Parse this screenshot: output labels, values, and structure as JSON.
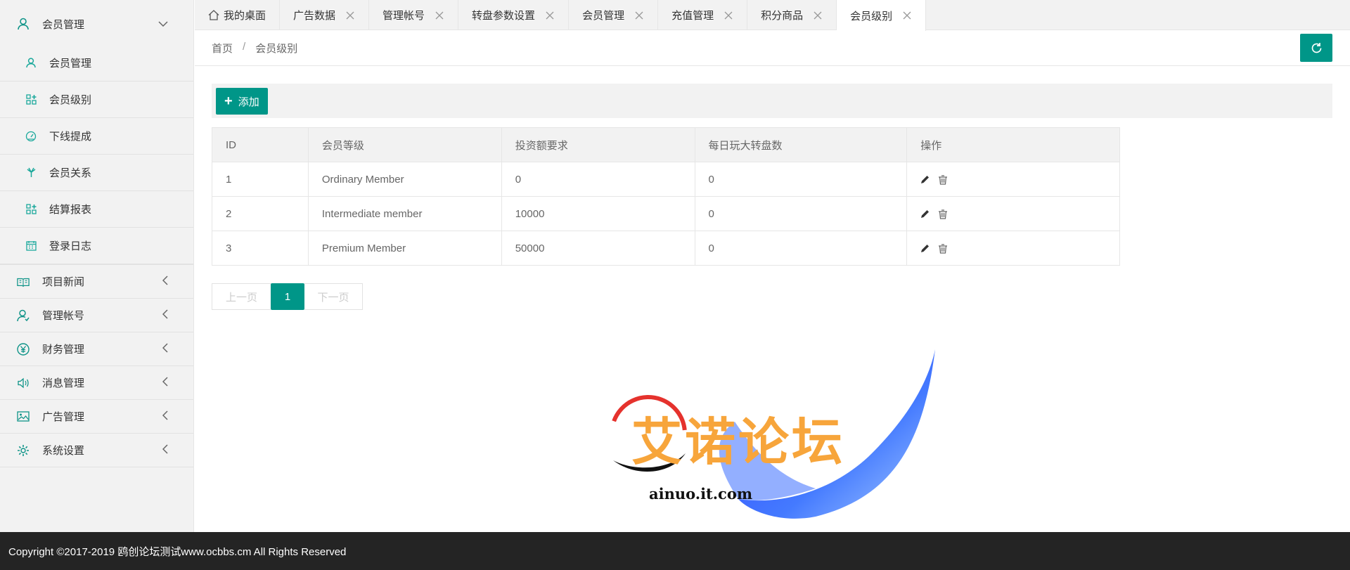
{
  "sidebar": {
    "member_group": {
      "label": "会员管理",
      "icon": "user-icon",
      "items": [
        {
          "label": "会员管理",
          "icon": "user-icon"
        },
        {
          "label": "会员级别",
          "icon": "grid-plus-icon"
        },
        {
          "label": "下线提成",
          "icon": "gauge-icon"
        },
        {
          "label": "会员关系",
          "icon": "network-icon"
        },
        {
          "label": "结算报表",
          "icon": "grid-plus-icon"
        },
        {
          "label": "登录日志",
          "icon": "calendar-icon"
        }
      ]
    },
    "groups": [
      {
        "label": "项目新闻",
        "icon": "book-icon"
      },
      {
        "label": "管理帐号",
        "icon": "admin-user-icon"
      },
      {
        "label": "财务管理",
        "icon": "yen-icon"
      },
      {
        "label": "消息管理",
        "icon": "speaker-icon"
      },
      {
        "label": "广告管理",
        "icon": "image-icon"
      },
      {
        "label": "系统设置",
        "icon": "gear-icon"
      }
    ]
  },
  "tabs": [
    {
      "label": "我的桌面"
    },
    {
      "label": "广告数据"
    },
    {
      "label": "管理帐号"
    },
    {
      "label": "转盘参数设置"
    },
    {
      "label": "会员管理"
    },
    {
      "label": "充值管理"
    },
    {
      "label": "积分商品"
    },
    {
      "label": "会员级别"
    }
  ],
  "breadcrumb": {
    "home": "首页",
    "separator": "/",
    "current": "会员级别"
  },
  "toolbar": {
    "add_label": "添加"
  },
  "table": {
    "headers": [
      "ID",
      "会员等级",
      "投资额要求",
      "每日玩大转盘数",
      "操作"
    ],
    "rows": [
      [
        "1",
        "Ordinary Member",
        "0",
        "0"
      ],
      [
        "2",
        "Intermediate member",
        "10000",
        "0"
      ],
      [
        "3",
        "Premium Member",
        "50000",
        "0"
      ]
    ]
  },
  "pager": {
    "prev": "上一页",
    "current": "1",
    "next": "下一页"
  },
  "watermark": {
    "title": "艾诺论坛",
    "url": "ainuo.it.com"
  },
  "footer": {
    "text": "Copyright ©2017-2019 鸥创论坛测试www.ocbbs.cm All Rights Reserved"
  },
  "colors": {
    "accent": "#009688",
    "sidebar_bg": "#f2f2f2",
    "footer_bg": "#242424"
  }
}
